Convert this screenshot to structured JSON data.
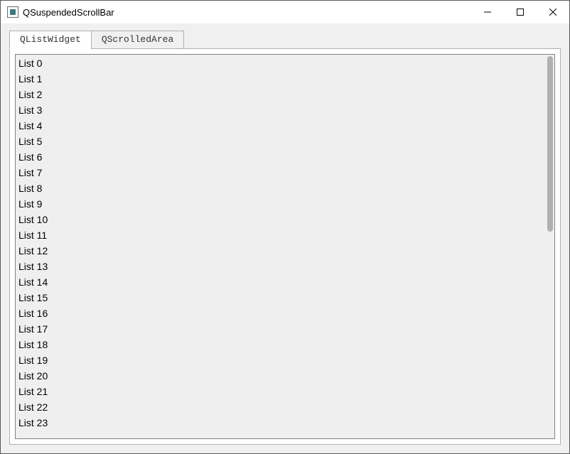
{
  "window": {
    "title": "QSuspendedScrollBar"
  },
  "tabs": [
    {
      "label": "QListWidget",
      "active": true
    },
    {
      "label": "QScrolledArea",
      "active": false
    }
  ],
  "list": {
    "items": [
      "List 0",
      "List 1",
      "List 2",
      "List 3",
      "List 4",
      "List 5",
      "List 6",
      "List 7",
      "List 8",
      "List 9",
      "List 10",
      "List 11",
      "List 12",
      "List 13",
      "List 14",
      "List 15",
      "List 16",
      "List 17",
      "List 18",
      "List 19",
      "List 20",
      "List 21",
      "List 22",
      "List 23"
    ]
  },
  "scrollbar": {
    "thumb_ratio": 0.46
  }
}
